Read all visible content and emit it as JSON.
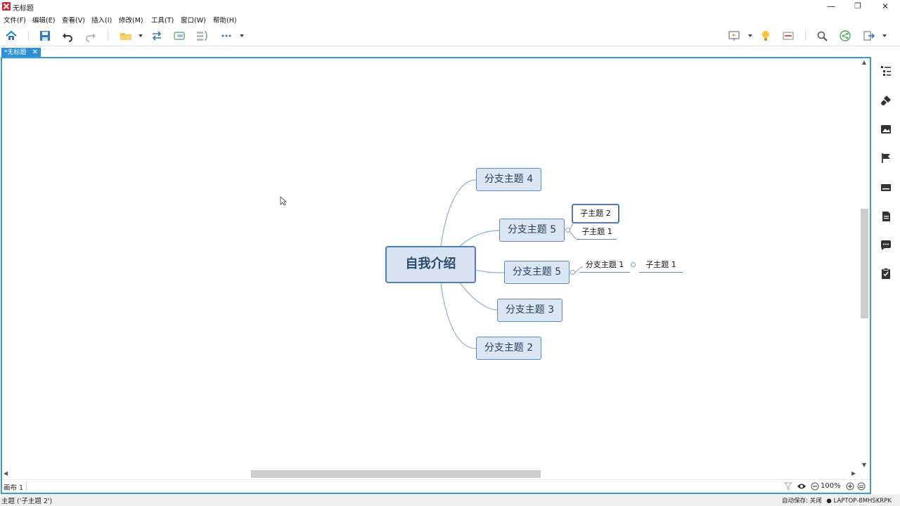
{
  "window": {
    "title": "无标题",
    "controls": {
      "minimize": "—",
      "maximize": "❐",
      "close": "✕"
    }
  },
  "menu": [
    "文件(F)",
    "编辑(E)",
    "查看(V)",
    "插入(I)",
    "修改(M)",
    "工具(T)",
    "窗口(W)",
    "帮助(H)"
  ],
  "toolbar": {
    "icons": [
      "home-icon",
      "save-icon",
      "undo-icon",
      "redo-icon",
      "folder-icon",
      "relationship-icon",
      "boundary-icon",
      "summary-icon",
      "more-icon",
      "presentation-icon",
      "idea-icon",
      "layout-icon",
      "search-icon",
      "share-icon",
      "export-icon"
    ]
  },
  "tab": {
    "label": "*无标题",
    "close": "✕"
  },
  "mindmap": {
    "central": "自我介绍",
    "branches": [
      "分支主题 4",
      "分支主题 5",
      "分支主题 5",
      "分支主题 3",
      "分支主题 2"
    ],
    "subtopics_b2": [
      "子主题 2",
      "子主题 1"
    ],
    "subtopics_b3": [
      "分支主题 1"
    ],
    "subtopics_b3_child": [
      "子主题 1"
    ],
    "colors": {
      "branch_border": "#5e86b6",
      "branch_fill": "#dbe6f3",
      "line": "#8fb0d4",
      "frame": "#3a9bd8"
    }
  },
  "sheet": {
    "name": "画布 1"
  },
  "zoom": {
    "level": "100%"
  },
  "status": {
    "left": "主题 ('子主题 2')",
    "autosave": "自动保存: 关闭",
    "computer": "● LAPTOP-8MHSKRPK"
  },
  "right_panel": {
    "icons": [
      "outline-icon",
      "style-icon",
      "image-icon",
      "marker-icon",
      "format-painter-icon",
      "notes-icon",
      "comment-icon",
      "task-icon"
    ]
  }
}
